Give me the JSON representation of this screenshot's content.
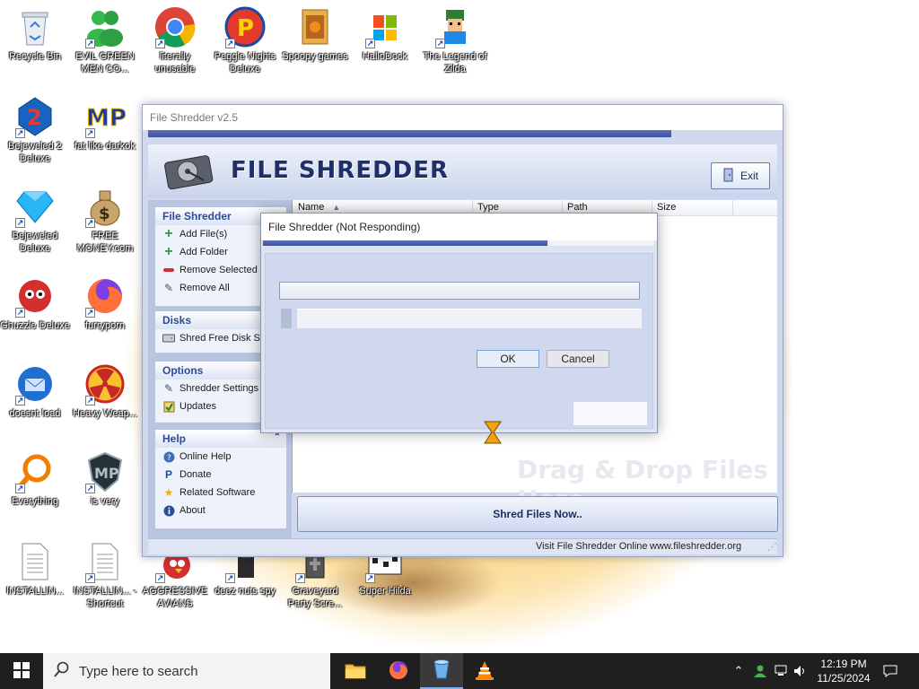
{
  "desktop": {
    "icons": [
      {
        "label": "Recycle Bin",
        "icon": "recycle-bin-icon",
        "shortcut": false
      },
      {
        "label": "EVIL GREEN MEN CO...",
        "icon": "green-men-icon",
        "shortcut": true
      },
      {
        "label": "literally unusable",
        "icon": "chrome-icon",
        "shortcut": true
      },
      {
        "label": "Peggle Nights Deluxe",
        "icon": "peggle-icon",
        "shortcut": true
      },
      {
        "label": "Spoopy games",
        "icon": "folder-games-icon",
        "shortcut": false
      },
      {
        "label": "HalloDock",
        "icon": "windows-shield-icon",
        "shortcut": true
      },
      {
        "label": "The Legend of Zilda",
        "icon": "zilda-icon",
        "shortcut": true
      },
      {
        "label": "Bejeweled 2 Deluxe",
        "icon": "bejeweled2-icon",
        "shortcut": true
      },
      {
        "label": "fat like darkok",
        "icon": "mpl-icon",
        "shortcut": true
      },
      {
        "label": "Bejeweled Deluxe",
        "icon": "bejeweled-icon",
        "shortcut": true
      },
      {
        "label": "FREE MONEY.com",
        "icon": "money-bag-icon",
        "shortcut": true
      },
      {
        "label": "Ghuzzle Deluxe",
        "icon": "zuma-icon",
        "shortcut": true
      },
      {
        "label": "furryporn",
        "icon": "firefox-icon",
        "shortcut": true
      },
      {
        "label": "doesnt load",
        "icon": "thunderbird-icon",
        "shortcut": true
      },
      {
        "label": "Heavy Weap...",
        "icon": "radiation-icon",
        "shortcut": true
      },
      {
        "label": "Everything",
        "icon": "everything-search-icon",
        "shortcut": true
      },
      {
        "label": "is very",
        "icon": "mpl-shield-icon",
        "shortcut": true
      },
      {
        "label": "INSTALLIN...",
        "icon": "text-file-icon",
        "shortcut": false
      },
      {
        "label": "INSTALLIN... - Shortcut",
        "icon": "text-file-icon",
        "shortcut": true
      },
      {
        "label": "AGGRESSIVE AVIANS",
        "icon": "angry-bird-icon",
        "shortcut": true
      },
      {
        "label": "deez nuts spy",
        "icon": "spy-icon",
        "shortcut": true
      },
      {
        "label": "Graveyard Party Scre...",
        "icon": "graveyard-icon",
        "shortcut": true
      },
      {
        "label": "Super Hilda",
        "icon": "hilda-icon",
        "shortcut": true
      }
    ]
  },
  "main_window": {
    "title": "File Shredder v2.5",
    "brand": "FILE SHREDDER",
    "exit_label": "Exit",
    "sidebar": {
      "file_shredder": {
        "heading": "File Shredder",
        "items": [
          "Add File(s)",
          "Add Folder",
          "Remove Selected",
          "Remove All"
        ]
      },
      "disks": {
        "heading": "Disks",
        "items": [
          "Shred Free Disk Sp"
        ]
      },
      "options": {
        "heading": "Options",
        "items": [
          "Shredder Settings",
          "Updates"
        ]
      },
      "help": {
        "heading": "Help",
        "items": [
          "Online Help",
          "Donate",
          "Related Software",
          "About"
        ]
      }
    },
    "list": {
      "columns": [
        "Name",
        "Type",
        "Path",
        "Size"
      ],
      "drop_hint": "Drag & Drop Files Here"
    },
    "shred_button": "Shred Files Now..",
    "status": {
      "link_label": "Visit File Shredder Online",
      "url": "www.fileshredder.org"
    }
  },
  "dialog": {
    "title": "File Shredder (Not Responding)",
    "ok_label": "OK",
    "cancel_label": "Cancel"
  },
  "taskbar": {
    "search_placeholder": "Type here to search",
    "apps": [
      "file-explorer-icon",
      "firefox-icon",
      "file-shredder-icon",
      "vlc-icon"
    ],
    "time": "12:19 PM",
    "date": "11/25/2024"
  },
  "colors": {
    "brand_navy": "#1e2f6b",
    "panel_heading": "#2b4b9b",
    "wallpaper_orange": "#f2a20a",
    "taskbar": "#1f1f1f"
  }
}
